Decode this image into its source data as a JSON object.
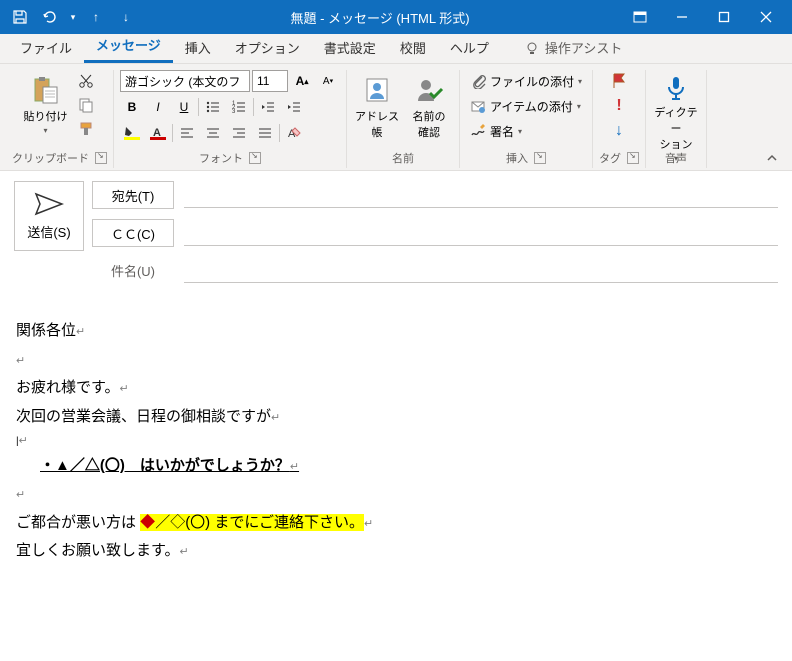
{
  "titlebar": {
    "title": "無題  -  メッセージ (HTML 形式)"
  },
  "tabs": {
    "file": "ファイル",
    "message": "メッセージ",
    "insert": "挿入",
    "options": "オプション",
    "format": "書式設定",
    "review": "校閲",
    "help": "ヘルプ",
    "tellme": "操作アシスト"
  },
  "ribbon": {
    "clipboard": {
      "paste": "貼り付け",
      "label": "クリップボード"
    },
    "font": {
      "name": "游ゴシック (本文のフ",
      "size": "11",
      "label": "フォント"
    },
    "names": {
      "address": "アドレス帳",
      "check": "名前の\n確認",
      "label": "名前"
    },
    "include": {
      "attachfile": "ファイルの添付",
      "attachitem": "アイテムの添付",
      "signature": "署名",
      "label": "挿入"
    },
    "tags": {
      "label": "タグ"
    },
    "voice": {
      "dictate": "ディクテー\nション",
      "label": "音声"
    }
  },
  "compose": {
    "send": "送信(S)",
    "to": "宛先(T)",
    "cc": "ＣＣ(C)",
    "subject": "件名(U)"
  },
  "body": {
    "l1": "関係各位",
    "l2": "お疲れ様です。",
    "l3": "次回の営業会議、日程の御相談ですが",
    "l4": "・▲／△(〇)　はいかがでしょうか？",
    "l5a": "ご都合が悪い方は ",
    "l5b": "◆",
    "l5c": "／◇(〇)  までにご連絡下さい。",
    "l6": "宜しくお願い致します。"
  }
}
